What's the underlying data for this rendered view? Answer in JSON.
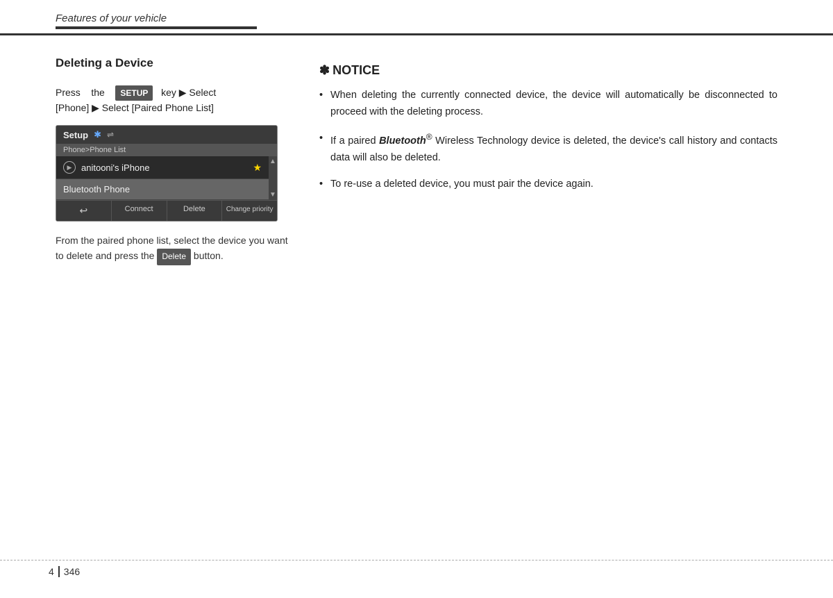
{
  "header": {
    "title": "Features of your vehicle"
  },
  "left": {
    "section_title": "Deleting a Device",
    "press_instruction_1": "Press   the",
    "setup_badge": "SETUP",
    "press_instruction_2": "key",
    "press_instruction_3": "Select [Phone]",
    "press_instruction_4": "Select [Paired Phone List]",
    "ui": {
      "titlebar": "Setup",
      "bluetooth_icon": "✱",
      "wifi_icon": "⇌",
      "subtitle": "Phone>Phone List",
      "item1": "anitooni's iPhone",
      "item2": "Bluetooth Phone",
      "btn_back": "↩",
      "btn_connect": "Connect",
      "btn_delete": "Delete",
      "btn_change": "Change priority"
    },
    "from_instruction_1": "From the paired phone list, select the device you want to delete and press the",
    "delete_badge": "Delete",
    "from_instruction_2": "button."
  },
  "right": {
    "notice_symbol": "✽",
    "notice_title": "NOTICE",
    "bullets": [
      {
        "text": "When deleting the currently connected device, the device will automatically be disconnected to proceed with the deleting process."
      },
      {
        "text_before": "If a paired ",
        "bluetooth_word": "Bluetooth",
        "superscript": "®",
        "text_after": " Wireless Technology device is deleted, the device's call history and contacts data will also be deleted."
      },
      {
        "text": "To re-use a deleted device, you must pair the device again."
      }
    ]
  },
  "footer": {
    "chapter": "4",
    "page": "346"
  }
}
